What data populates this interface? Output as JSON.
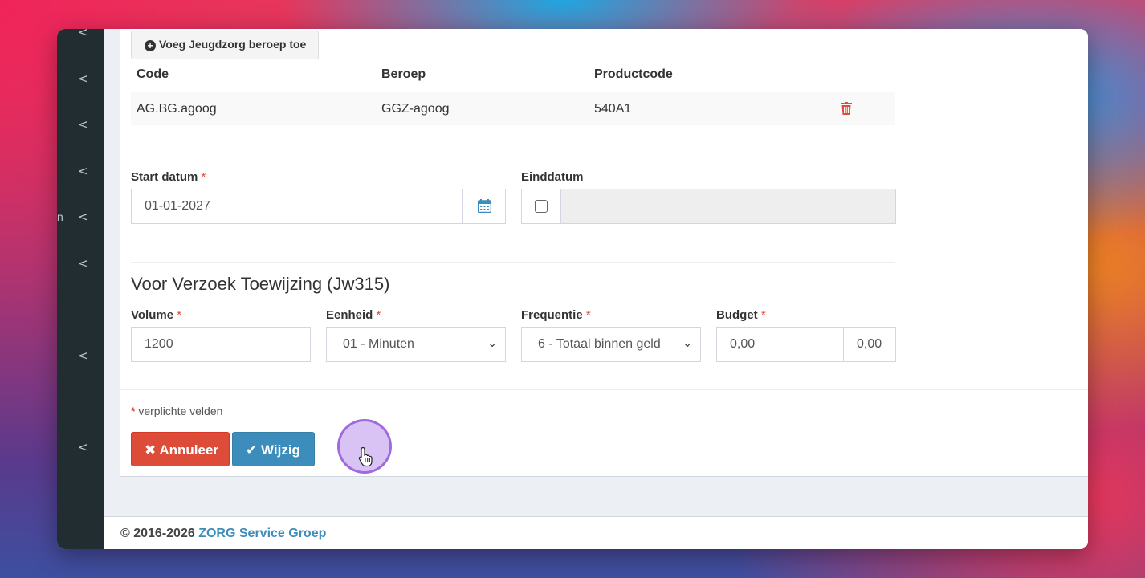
{
  "sidebar": {
    "partial_label": "n",
    "chevrons": [
      "<",
      "<",
      "<",
      "<",
      "<",
      "<",
      "<",
      "<"
    ]
  },
  "professions": {
    "add_button_label": "Voeg Jeugdzorg beroep toe",
    "columns": [
      "Code",
      "Beroep",
      "Productcode"
    ],
    "rows": [
      {
        "code": "AG.BG.agoog",
        "beroep": "GGZ-agoog",
        "productcode": "540A1"
      }
    ]
  },
  "dates": {
    "start_label": "Start datum",
    "start_value": "01-01-2027",
    "end_label": "Einddatum",
    "end_value": ""
  },
  "allocation": {
    "title": "Voor Verzoek Toewijzing (Jw315)",
    "volume_label": "Volume",
    "volume_value": "1200",
    "unit_label": "Eenheid",
    "unit_value": "01 - Minuten",
    "frequency_label": "Frequentie",
    "frequency_value": "6 - Totaal binnen geld",
    "budget_label": "Budget",
    "budget_value": "0,00",
    "budget_addon": "0,00"
  },
  "form": {
    "required_marker": "*",
    "required_note": "verplichte velden",
    "cancel_label": "Annuleer",
    "save_label": "Wijzig"
  },
  "footer": {
    "copyright": "© 2016-2026",
    "brand": "ZORG Service Groep"
  },
  "colors": {
    "sidebar_bg": "#222d32",
    "danger": "#dd4b39",
    "primary": "#3c8dbc"
  }
}
